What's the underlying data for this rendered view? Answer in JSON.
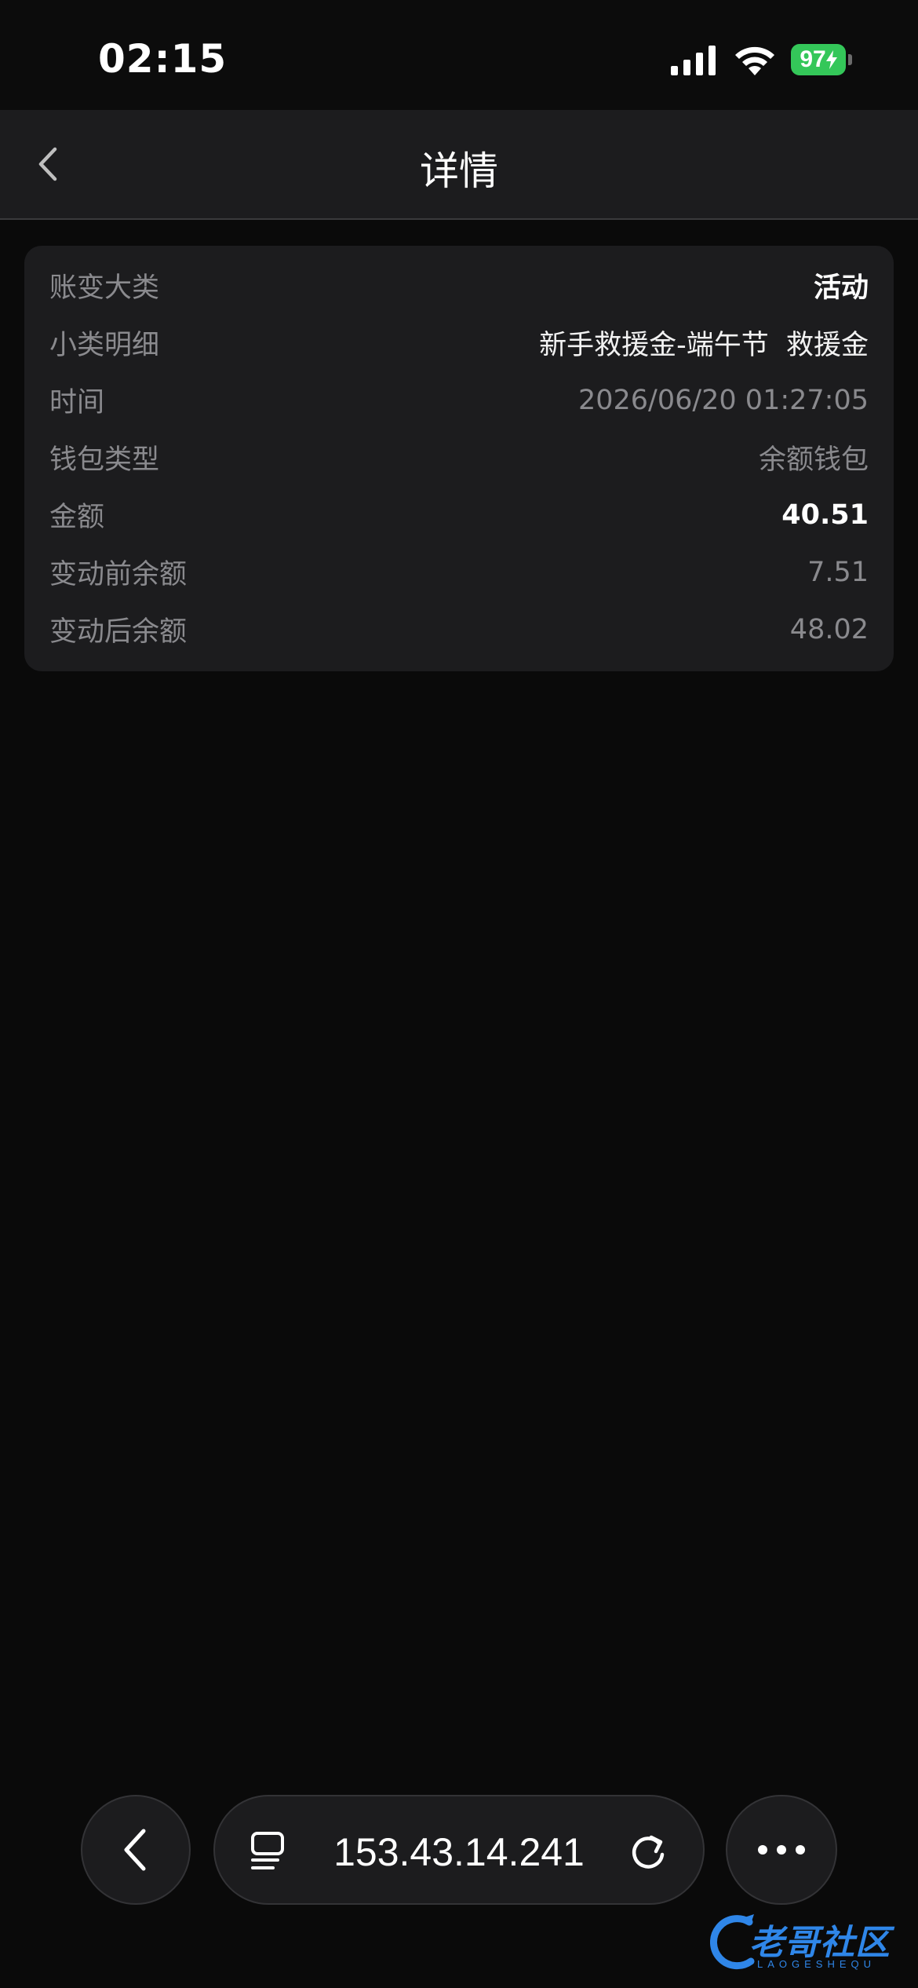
{
  "status_bar": {
    "time": "02:15",
    "battery": "97"
  },
  "nav": {
    "title": "详情"
  },
  "detail": {
    "rows": [
      {
        "label": "账变大类",
        "value": "活动"
      },
      {
        "label": "小类明细",
        "value": "新手救援金-端午节  救援金"
      },
      {
        "label": "时间",
        "value": "2026/06/20 01:27:05"
      },
      {
        "label": "钱包类型",
        "value": "余额钱包"
      },
      {
        "label": "金额",
        "value": "40.51"
      },
      {
        "label": "变动前余额",
        "value": "7.51"
      },
      {
        "label": "变动后余额",
        "value": "48.02"
      }
    ]
  },
  "browser": {
    "url": "153.43.14.241"
  },
  "watermark": {
    "text": "老哥社区",
    "sub": "LAOGESHEQU"
  },
  "colors": {
    "battery": "#34c759",
    "watermark": "#2f86e8"
  }
}
